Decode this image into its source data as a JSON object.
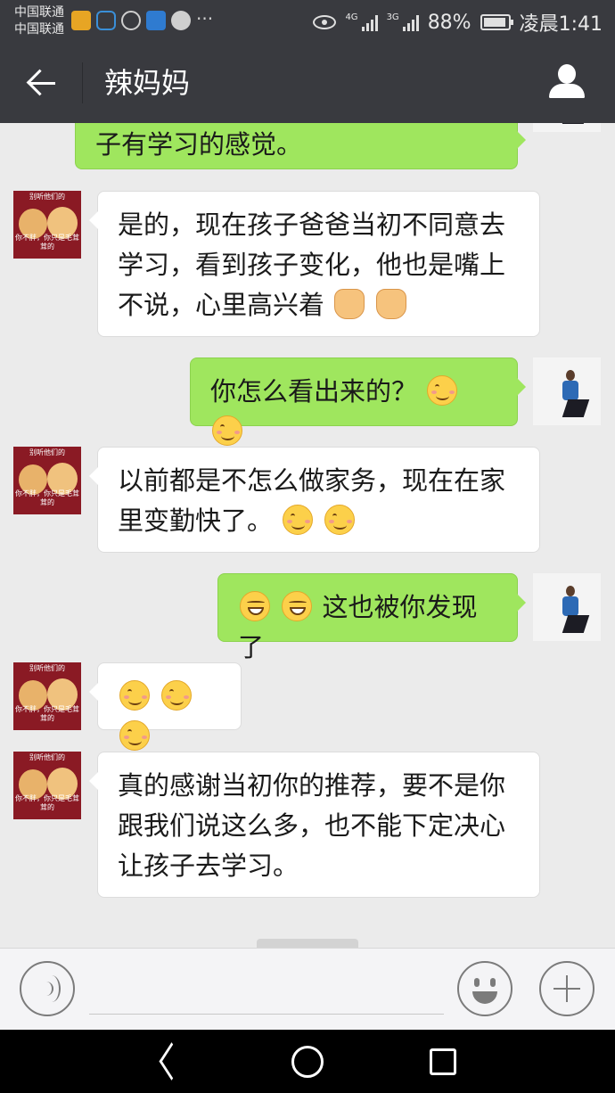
{
  "status_bar": {
    "carrier_1": "中国联通",
    "carrier_2": "中国联通",
    "network_1": "4G",
    "network_2": "3G",
    "battery": "88%",
    "time": "凌晨1:41",
    "more": "···"
  },
  "header": {
    "title": "辣妈妈"
  },
  "messages": [
    {
      "side": "sent",
      "text": "子有学习的感觉。",
      "emojis": []
    },
    {
      "side": "received",
      "text": "是的，现在孩子爸爸当初不同意去学习，看到孩子变化，他也是嘴上不说，心里高兴着",
      "emojis": [
        "victory-hand",
        "victory-hand"
      ]
    },
    {
      "side": "sent",
      "text": "你怎么看出来的？",
      "emojis": [
        "blush-smile",
        "blush-smile"
      ]
    },
    {
      "side": "received",
      "text": "以前都是不怎么做家务，现在在家里变勤快了。",
      "emojis": [
        "blush-smile",
        "blush-smile"
      ]
    },
    {
      "side": "sent",
      "text": "这也被你发现了",
      "emojis": [
        "grin",
        "grin"
      ]
    },
    {
      "side": "received",
      "text": "",
      "emojis": [
        "blush-smile",
        "blush-smile",
        "blush-smile"
      ]
    },
    {
      "side": "received",
      "text": "真的感谢当初你的推荐，要不是你跟我们说这么多，也不能下定决心让孩子去学习。",
      "emojis": []
    }
  ],
  "avatar_kittens": {
    "caption_top": "别听他们的",
    "caption_bottom": "你不胖，你只是毛茸茸的"
  },
  "input_bar": {
    "placeholder": ""
  },
  "colors": {
    "title_bar": "#393a3f",
    "sent_bubble": "#9fe65e",
    "received_bubble": "#ffffff",
    "chat_background": "#ebebeb"
  }
}
